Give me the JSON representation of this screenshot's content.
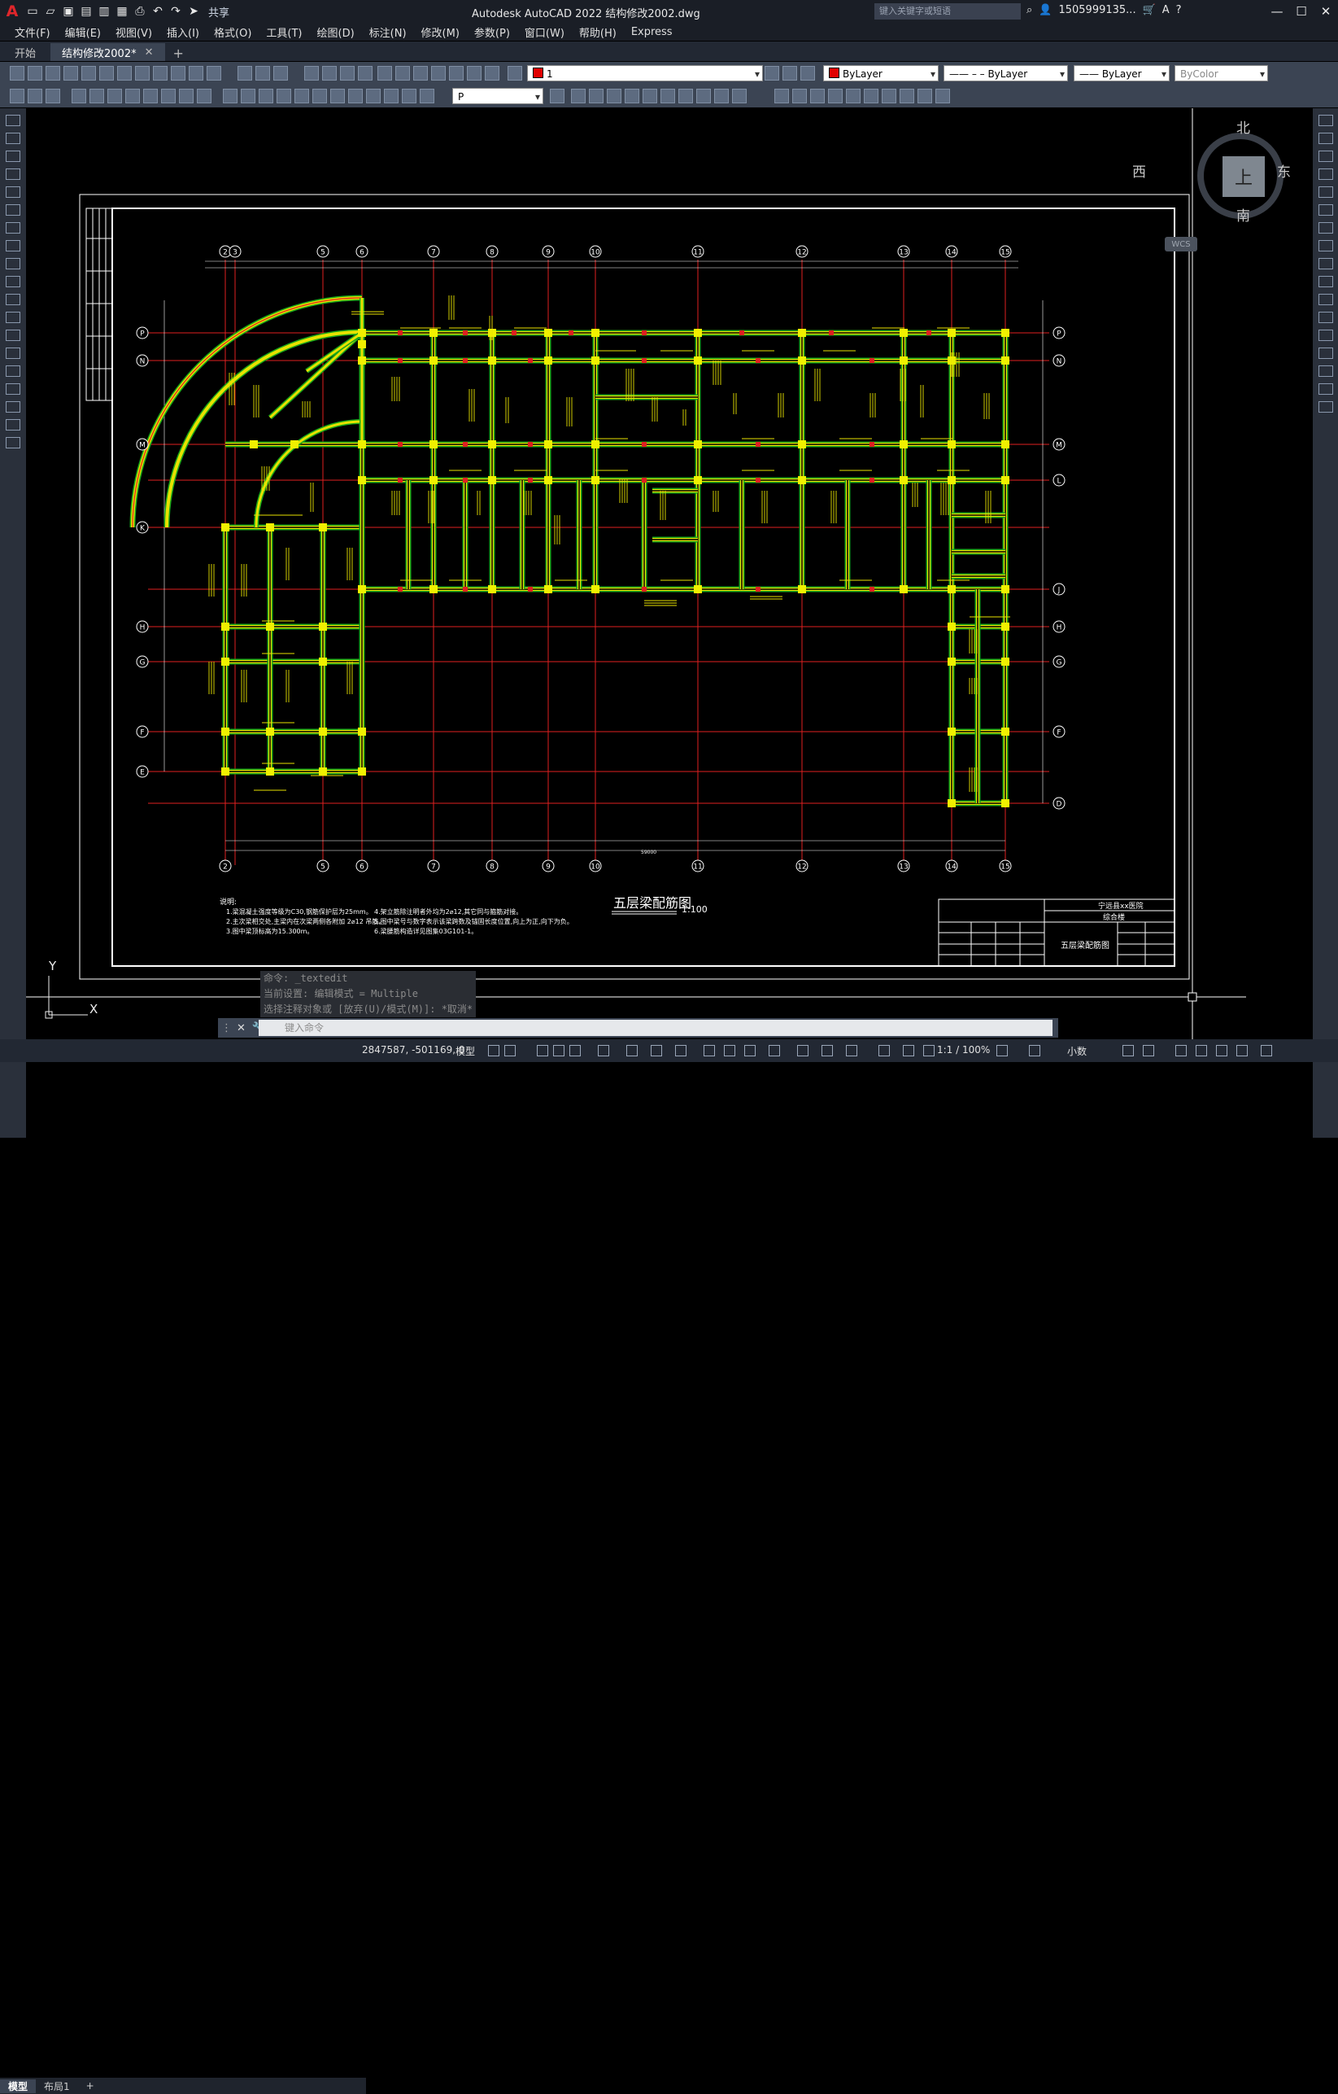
{
  "app": {
    "logo": "A",
    "window_title": "Autodesk AutoCAD 2022    结构修改2002.dwg",
    "share_label": "共享",
    "search_placeholder": "键入关键字或短语",
    "user_name": "1505999135...",
    "menu": [
      "文件(F)",
      "编辑(E)",
      "视图(V)",
      "插入(I)",
      "格式(O)",
      "工具(T)",
      "绘图(D)",
      "标注(N)",
      "修改(M)",
      "参数(P)",
      "窗口(W)",
      "帮助(H)",
      "Express"
    ]
  },
  "tabs": {
    "start": "开始",
    "active": "结构修改2002*"
  },
  "toolbar": {
    "layer_value": "1",
    "color_value": "ByLayer",
    "linetype_value": "ByLayer",
    "lineweight_value": "ByLayer",
    "plotstyle_value": "ByColor",
    "textstyle_value": "P"
  },
  "viewcube": {
    "north": "北",
    "south": "南",
    "east": "东",
    "west": "西",
    "top": "上",
    "wcs": "WCS"
  },
  "drawing": {
    "title": "五层梁配筋图",
    "scale": "1:100",
    "grid_top": [
      "2",
      "3",
      "5",
      "6",
      "7",
      "8",
      "9",
      "10",
      "11",
      "12",
      "13",
      "14",
      "15"
    ],
    "grid_bottom": [
      "2",
      "5",
      "6",
      "7",
      "8",
      "9",
      "10",
      "11",
      "12",
      "13",
      "14",
      "15"
    ],
    "grid_left": [
      "P",
      "N",
      "M",
      "K",
      "H",
      "G",
      "F",
      "E"
    ],
    "grid_right": [
      "P",
      "N",
      "M",
      "L",
      "J",
      "H",
      "G",
      "F",
      "D"
    ],
    "notes_title": "说明:",
    "notes_left": [
      "1.梁混凝土强度等级为C30,钢筋保护层为25mm。",
      "2.主次梁相交处,主梁内在次梁两侧各附加 2⌀12 吊筋。",
      "3.图中梁顶标高为15.300m。"
    ],
    "notes_right": [
      "4.架立筋除注明者外均为2⌀12,其它同与箍筋对接。",
      "5.图中梁号与数字表示该梁跨数及锚固长度位置,向上为正,向下为负。",
      "6.梁腰筋构造详见图集03G101-1。"
    ],
    "tb_project": "宁远县xx医院",
    "tb_sub": "综合楼",
    "tb_name": "五层梁配筋图",
    "total_dim": "59000"
  },
  "command": {
    "history": [
      "命令: _textedit",
      "当前设置: 编辑模式 = Multiple",
      "选择注释对象或 [放弃(U)/模式(M)]: *取消*"
    ],
    "placeholder": "键入命令"
  },
  "layouts": [
    "模型",
    "布局1"
  ],
  "status": {
    "coords": "2847587, -501169, 0",
    "mode": "模型",
    "scale": "1:1 / 100%",
    "units": "小数"
  },
  "ucs": {
    "x": "X",
    "y": "Y"
  }
}
